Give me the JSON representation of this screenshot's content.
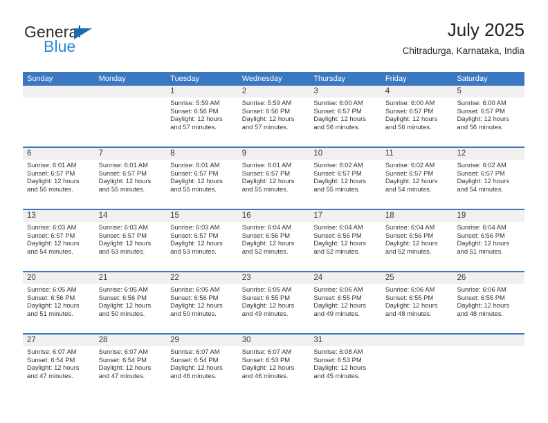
{
  "brand": {
    "name_top": "General",
    "name_bottom": "Blue",
    "triangle_icon": "triangle-icon",
    "accent_blue": "#2a87d8",
    "logo_triangle_blue": "#1b6cb5"
  },
  "header": {
    "title": "July 2025",
    "subtitle": "Chitradurga, Karnataka, India"
  },
  "colors": {
    "header_row_blue": "#3a78c2",
    "week_separator_blue": "#3a78c2",
    "date_band_gray": "#f0f0f0",
    "text_dark": "#333333"
  },
  "calendar": {
    "day_headers": [
      "Sunday",
      "Monday",
      "Tuesday",
      "Wednesday",
      "Thursday",
      "Friday",
      "Saturday"
    ],
    "weeks": [
      [
        {
          "day": "",
          "lines": []
        },
        {
          "day": "",
          "lines": []
        },
        {
          "day": "1",
          "lines": [
            "Sunrise: 5:59 AM",
            "Sunset: 6:56 PM",
            "Daylight: 12 hours",
            "and 57 minutes."
          ]
        },
        {
          "day": "2",
          "lines": [
            "Sunrise: 5:59 AM",
            "Sunset: 6:56 PM",
            "Daylight: 12 hours",
            "and 57 minutes."
          ]
        },
        {
          "day": "3",
          "lines": [
            "Sunrise: 6:00 AM",
            "Sunset: 6:57 PM",
            "Daylight: 12 hours",
            "and 56 minutes."
          ]
        },
        {
          "day": "4",
          "lines": [
            "Sunrise: 6:00 AM",
            "Sunset: 6:57 PM",
            "Daylight: 12 hours",
            "and 56 minutes."
          ]
        },
        {
          "day": "5",
          "lines": [
            "Sunrise: 6:00 AM",
            "Sunset: 6:57 PM",
            "Daylight: 12 hours",
            "and 56 minutes."
          ]
        }
      ],
      [
        {
          "day": "6",
          "lines": [
            "Sunrise: 6:01 AM",
            "Sunset: 6:57 PM",
            "Daylight: 12 hours",
            "and 56 minutes."
          ]
        },
        {
          "day": "7",
          "lines": [
            "Sunrise: 6:01 AM",
            "Sunset: 6:57 PM",
            "Daylight: 12 hours",
            "and 55 minutes."
          ]
        },
        {
          "day": "8",
          "lines": [
            "Sunrise: 6:01 AM",
            "Sunset: 6:57 PM",
            "Daylight: 12 hours",
            "and 55 minutes."
          ]
        },
        {
          "day": "9",
          "lines": [
            "Sunrise: 6:01 AM",
            "Sunset: 6:57 PM",
            "Daylight: 12 hours",
            "and 55 minutes."
          ]
        },
        {
          "day": "10",
          "lines": [
            "Sunrise: 6:02 AM",
            "Sunset: 6:57 PM",
            "Daylight: 12 hours",
            "and 55 minutes."
          ]
        },
        {
          "day": "11",
          "lines": [
            "Sunrise: 6:02 AM",
            "Sunset: 6:57 PM",
            "Daylight: 12 hours",
            "and 54 minutes."
          ]
        },
        {
          "day": "12",
          "lines": [
            "Sunrise: 6:02 AM",
            "Sunset: 6:57 PM",
            "Daylight: 12 hours",
            "and 54 minutes."
          ]
        }
      ],
      [
        {
          "day": "13",
          "lines": [
            "Sunrise: 6:03 AM",
            "Sunset: 6:57 PM",
            "Daylight: 12 hours",
            "and 54 minutes."
          ]
        },
        {
          "day": "14",
          "lines": [
            "Sunrise: 6:03 AM",
            "Sunset: 6:57 PM",
            "Daylight: 12 hours",
            "and 53 minutes."
          ]
        },
        {
          "day": "15",
          "lines": [
            "Sunrise: 6:03 AM",
            "Sunset: 6:57 PM",
            "Daylight: 12 hours",
            "and 53 minutes."
          ]
        },
        {
          "day": "16",
          "lines": [
            "Sunrise: 6:04 AM",
            "Sunset: 6:56 PM",
            "Daylight: 12 hours",
            "and 52 minutes."
          ]
        },
        {
          "day": "17",
          "lines": [
            "Sunrise: 6:04 AM",
            "Sunset: 6:56 PM",
            "Daylight: 12 hours",
            "and 52 minutes."
          ]
        },
        {
          "day": "18",
          "lines": [
            "Sunrise: 6:04 AM",
            "Sunset: 6:56 PM",
            "Daylight: 12 hours",
            "and 52 minutes."
          ]
        },
        {
          "day": "19",
          "lines": [
            "Sunrise: 6:04 AM",
            "Sunset: 6:56 PM",
            "Daylight: 12 hours",
            "and 51 minutes."
          ]
        }
      ],
      [
        {
          "day": "20",
          "lines": [
            "Sunrise: 6:05 AM",
            "Sunset: 6:56 PM",
            "Daylight: 12 hours",
            "and 51 minutes."
          ]
        },
        {
          "day": "21",
          "lines": [
            "Sunrise: 6:05 AM",
            "Sunset: 6:56 PM",
            "Daylight: 12 hours",
            "and 50 minutes."
          ]
        },
        {
          "day": "22",
          "lines": [
            "Sunrise: 6:05 AM",
            "Sunset: 6:56 PM",
            "Daylight: 12 hours",
            "and 50 minutes."
          ]
        },
        {
          "day": "23",
          "lines": [
            "Sunrise: 6:05 AM",
            "Sunset: 6:55 PM",
            "Daylight: 12 hours",
            "and 49 minutes."
          ]
        },
        {
          "day": "24",
          "lines": [
            "Sunrise: 6:06 AM",
            "Sunset: 6:55 PM",
            "Daylight: 12 hours",
            "and 49 minutes."
          ]
        },
        {
          "day": "25",
          "lines": [
            "Sunrise: 6:06 AM",
            "Sunset: 6:55 PM",
            "Daylight: 12 hours",
            "and 48 minutes."
          ]
        },
        {
          "day": "26",
          "lines": [
            "Sunrise: 6:06 AM",
            "Sunset: 6:55 PM",
            "Daylight: 12 hours",
            "and 48 minutes."
          ]
        }
      ],
      [
        {
          "day": "27",
          "lines": [
            "Sunrise: 6:07 AM",
            "Sunset: 6:54 PM",
            "Daylight: 12 hours",
            "and 47 minutes."
          ]
        },
        {
          "day": "28",
          "lines": [
            "Sunrise: 6:07 AM",
            "Sunset: 6:54 PM",
            "Daylight: 12 hours",
            "and 47 minutes."
          ]
        },
        {
          "day": "29",
          "lines": [
            "Sunrise: 6:07 AM",
            "Sunset: 6:54 PM",
            "Daylight: 12 hours",
            "and 46 minutes."
          ]
        },
        {
          "day": "30",
          "lines": [
            "Sunrise: 6:07 AM",
            "Sunset: 6:53 PM",
            "Daylight: 12 hours",
            "and 46 minutes."
          ]
        },
        {
          "day": "31",
          "lines": [
            "Sunrise: 6:08 AM",
            "Sunset: 6:53 PM",
            "Daylight: 12 hours",
            "and 45 minutes."
          ]
        },
        {
          "day": "",
          "lines": []
        },
        {
          "day": "",
          "lines": []
        }
      ]
    ]
  }
}
